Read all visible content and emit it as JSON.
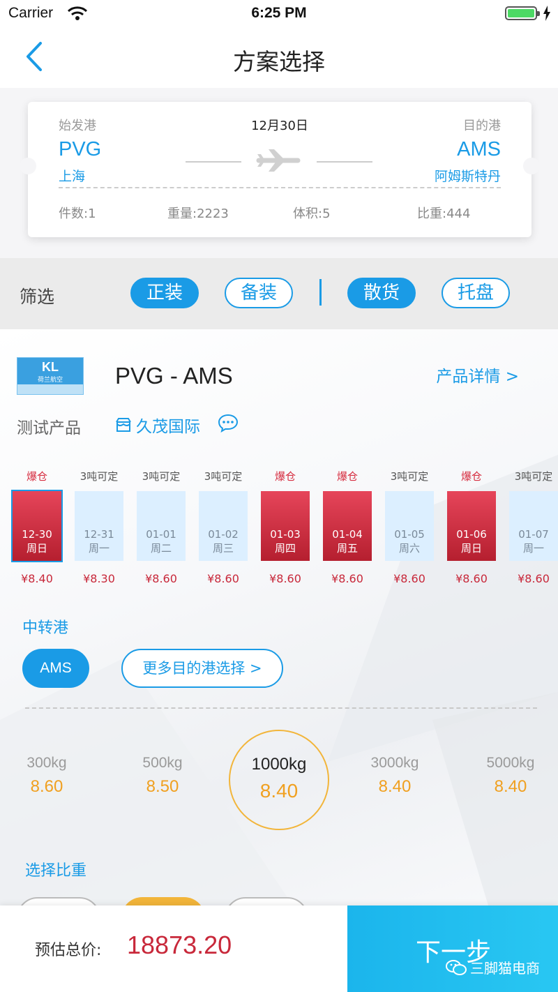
{
  "status_bar": {
    "carrier": "Carrier",
    "time": "6:25 PM"
  },
  "nav": {
    "title": "方案选择"
  },
  "ticket": {
    "origin_label": "始发港",
    "origin_code": "PVG",
    "origin_city": "上海",
    "date": "12月30日",
    "dest_label": "目的港",
    "dest_code": "AMS",
    "dest_city": "阿姆斯特丹",
    "stats": [
      "件数:1",
      "重量:2223",
      "体积:5",
      "比重:444"
    ]
  },
  "filter": {
    "label": "筛选",
    "options": [
      {
        "label": "正装",
        "active": true
      },
      {
        "label": "备装",
        "active": false
      },
      {
        "label": "散货",
        "active": true
      },
      {
        "label": "托盘",
        "active": false
      }
    ]
  },
  "product": {
    "logo_text": "KL",
    "logo_sub": "荷兰航空",
    "route": "PVG - AMS",
    "detail_link": "产品详情 >",
    "name": "测试产品",
    "agent": "久茂国际"
  },
  "dates": [
    {
      "status": "爆仓",
      "date": "12-30",
      "weekday": "周日",
      "price": "¥8.40",
      "hot": true,
      "selected": true
    },
    {
      "status": "3吨可定",
      "date": "12-31",
      "weekday": "周一",
      "price": "¥8.30",
      "hot": false,
      "selected": false
    },
    {
      "status": "3吨可定",
      "date": "01-01",
      "weekday": "周二",
      "price": "¥8.60",
      "hot": false,
      "selected": false
    },
    {
      "status": "3吨可定",
      "date": "01-02",
      "weekday": "周三",
      "price": "¥8.60",
      "hot": false,
      "selected": false
    },
    {
      "status": "爆仓",
      "date": "01-03",
      "weekday": "周四",
      "price": "¥8.60",
      "hot": true,
      "selected": false
    },
    {
      "status": "爆仓",
      "date": "01-04",
      "weekday": "周五",
      "price": "¥8.60",
      "hot": true,
      "selected": false
    },
    {
      "status": "3吨可定",
      "date": "01-05",
      "weekday": "周六",
      "price": "¥8.60",
      "hot": false,
      "selected": false
    },
    {
      "status": "爆仓",
      "date": "01-06",
      "weekday": "周日",
      "price": "¥8.60",
      "hot": true,
      "selected": false
    },
    {
      "status": "3吨可定",
      "date": "01-07",
      "weekday": "周一",
      "price": "¥8.60",
      "hot": false,
      "selected": false
    }
  ],
  "transfer": {
    "label": "中转港",
    "selected_port": "AMS",
    "more_button": "更多目的港选择 >"
  },
  "tiers": [
    {
      "weight": "300kg",
      "price": "8.60",
      "selected": false
    },
    {
      "weight": "500kg",
      "price": "8.50",
      "selected": false
    },
    {
      "weight": "1000kg",
      "price": "8.40",
      "selected": true
    },
    {
      "weight": "3000kg",
      "price": "8.40",
      "selected": false
    },
    {
      "weight": "5000kg",
      "price": "8.40",
      "selected": false
    }
  ],
  "density": {
    "label": "选择比重"
  },
  "bottom": {
    "estimate_label": "预估总价:",
    "estimate_value": "18873.20",
    "next_button": "下一步",
    "watermark": "三脚猫电商"
  },
  "colors": {
    "accent": "#1a9be6",
    "hot": "#d62c3f",
    "price": "#f0a020",
    "total": "#c8283a"
  }
}
